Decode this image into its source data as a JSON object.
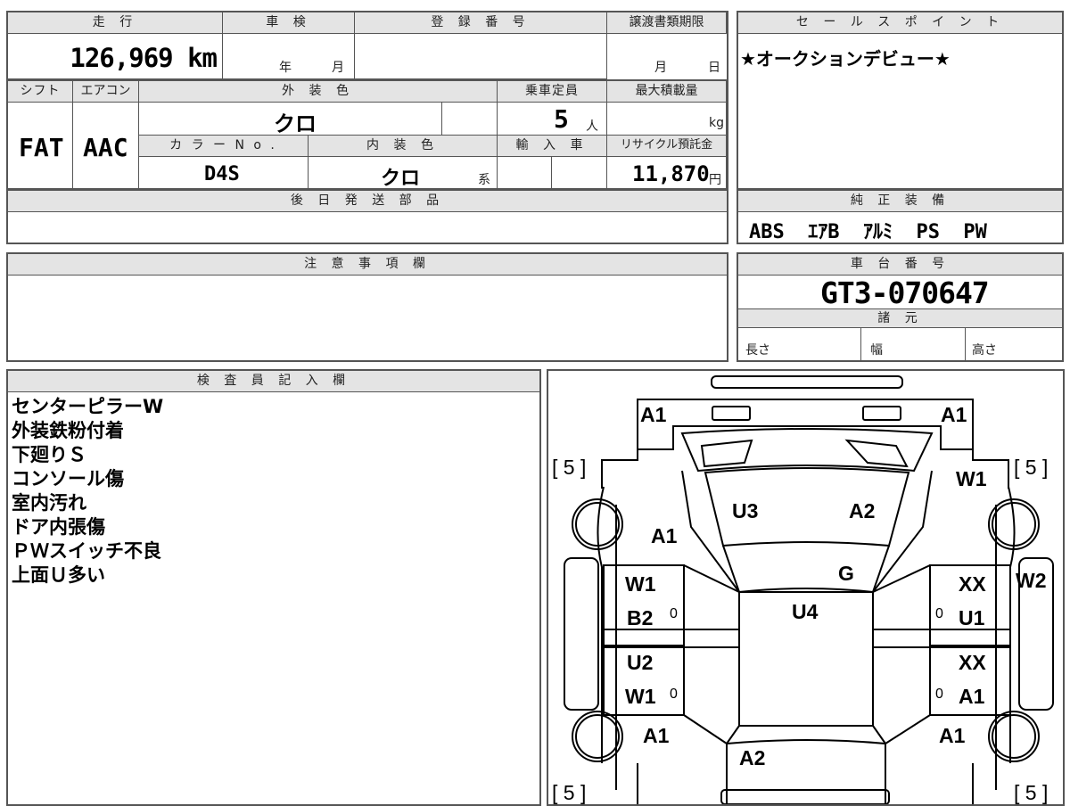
{
  "top": {
    "mileage_header": "走 行",
    "shaken_header": "車 検",
    "registration_header": "登 録 番 号",
    "transfer_deadline_header": "譲渡書類期限",
    "mileage_value": "126,969 km",
    "shaken_year_unit": "年",
    "shaken_month_unit": "月",
    "deadline_month_unit": "月",
    "deadline_day_unit": "日"
  },
  "row2": {
    "shift_header": "シフト",
    "aircon_header": "エアコン",
    "exterior_color_header": "外 装 色",
    "capacity_header": "乗車定員",
    "max_load_header": "最大積載量",
    "shift_value": "FAT",
    "aircon_value": "AAC",
    "exterior_color_value": "クロ",
    "capacity_value": "5",
    "capacity_unit": "人",
    "max_load_unit": "kg",
    "color_no_header": "カ ラ ー N o .",
    "interior_color_header": "内 装 色",
    "import_header": "輸 入 車",
    "recycle_header": "リサイクル預託金",
    "color_no_value": "D4S",
    "interior_color_value": "クロ",
    "interior_suffix": "系",
    "recycle_value": "11,870",
    "recycle_unit": "円"
  },
  "later_parts": {
    "header": "後 日 発 送 部 品",
    "value": ""
  },
  "notes": {
    "header": "注 意 事 項 欄",
    "value": ""
  },
  "sales_point": {
    "header": "セ ー ル ス ポ イ ン ト",
    "value": "★オークションデビュー★"
  },
  "equipment": {
    "header": "純 正 装 備",
    "value": "ABS  ｴｱB  ｱﾙﾐ  PS  PW"
  },
  "chassis": {
    "header": "車 台 番 号",
    "value": "GT3-070647"
  },
  "specs": {
    "header": "諸 元",
    "length_label": "長さ",
    "width_label": "幅",
    "height_label": "高さ"
  },
  "inspector": {
    "header": "検 査 員 記 入 欄",
    "lines": [
      "センターピラーW",
      "外装鉄粉付着",
      "下廻りＳ",
      "コンソール傷",
      "室内汚れ",
      "ドア内張傷",
      "ＰＷスイッチ不良",
      "上面Ｕ多い"
    ]
  },
  "diagram": {
    "marks": {
      "front_left_top": "A1",
      "front_right_top": "A1",
      "tire_fl": "[ 5 ]",
      "tire_fr": "[ 5 ]",
      "tire_rl": "[ 5 ]",
      "tire_rr": "[ 5 ]",
      "right_front_fender": "W1",
      "hood_left": "U3",
      "hood_right": "A2",
      "left_front_fender": "A1",
      "windshield": "G",
      "roof": "U4",
      "left_front_door_1": "W1",
      "left_front_door_2": "B2",
      "left_rear_door_1": "U2",
      "left_rear_door_2": "W1",
      "right_front_door_1": "XX",
      "right_front_door_2": "U1",
      "right_rear_door_1": "XX",
      "right_rear_door_2": "A1",
      "right_side_panel": "W2",
      "left_rear_fender": "A1",
      "right_rear_fender": "A1",
      "rear": "A2",
      "door_small_1": "0",
      "door_small_2": "0",
      "door_small_3": "0",
      "door_small_4": "0"
    }
  }
}
